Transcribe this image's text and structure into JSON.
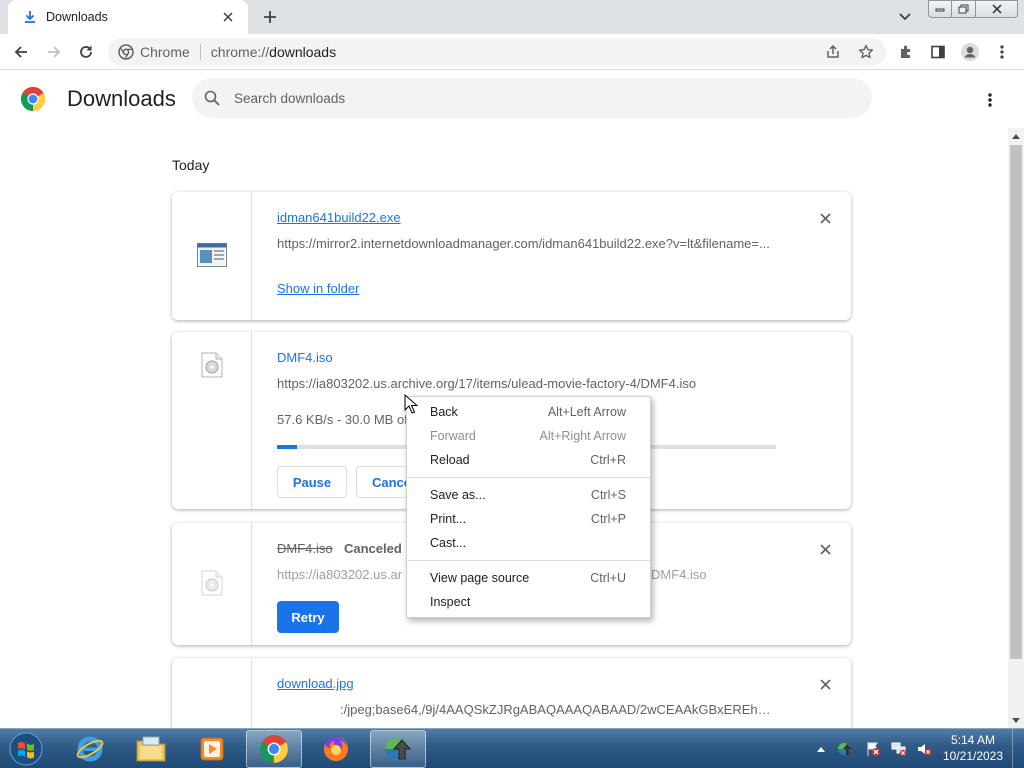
{
  "browser": {
    "tab_title": "Downloads",
    "new_tab_symbol": "+",
    "omnibox": {
      "site_label": "Chrome",
      "url_scheme": "chrome://",
      "url_host": "downloads"
    },
    "icons": [
      "download-icon",
      "close-icon",
      "plus-icon",
      "chevron-down-icon",
      "back-arrow-icon",
      "forward-arrow-icon",
      "reload-icon",
      "chrome-site-icon",
      "share-icon",
      "star-icon",
      "extensions-icon",
      "side-panel-icon",
      "profile-icon",
      "kebab-menu-icon"
    ]
  },
  "page": {
    "title": "Downloads",
    "search_placeholder": "Search downloads",
    "date_header": "Today"
  },
  "downloads": [
    {
      "filename": "idman641build22.exe",
      "url": "https://mirror2.internetdownloadmanager.com/idman641build22.exe?v=lt&filename=...",
      "action": "Show in folder"
    },
    {
      "filename": "DMF4.iso",
      "url": "https://ia803202.us.archive.org/17/items/ulead-movie-factory-4/DMF4.iso",
      "progress_text": "57.6 KB/s - 30.0 MB of",
      "progress_fraction": 0.04,
      "pause_label": "Pause",
      "cancel_label": "Cance"
    },
    {
      "filename": "DMF4.iso",
      "status": "Canceled",
      "url_left": "https://ia803202.us.ar",
      "url_right": "DMF4.iso",
      "retry_label": "Retry"
    },
    {
      "filename": "download.jpg",
      "url": ":/jpeg;base64,/9j/4AAQSkZJRgABAQAAAQABAAD/2wCEAAkGBxEREhUSE..."
    }
  ],
  "context_menu": {
    "items": [
      {
        "label": "Back",
        "shortcut": "Alt+Left Arrow",
        "disabled": false
      },
      {
        "label": "Forward",
        "shortcut": "Alt+Right Arrow",
        "disabled": true
      },
      {
        "label": "Reload",
        "shortcut": "Ctrl+R",
        "disabled": false
      },
      {
        "label": "Save as...",
        "shortcut": "Ctrl+S",
        "disabled": false
      },
      {
        "label": "Print...",
        "shortcut": "Ctrl+P",
        "disabled": false
      },
      {
        "label": "Cast...",
        "shortcut": "",
        "disabled": false
      },
      {
        "label": "View page source",
        "shortcut": "Ctrl+U",
        "disabled": false
      },
      {
        "label": "Inspect",
        "shortcut": "",
        "disabled": false
      }
    ]
  },
  "taskbar": {
    "apps": [
      "internet-explorer-icon",
      "file-explorer-icon",
      "media-player-icon",
      "chrome-icon",
      "firefox-icon",
      "idm-icon"
    ],
    "active_app": "chrome-icon",
    "clock_time": "5:14 AM",
    "clock_date": "10/21/2023"
  },
  "colors": {
    "accent": "#1a73e8",
    "tab_strip": "#dee1e6",
    "omnibox_bg": "#f1f3f4",
    "taskbar": "#2e5a85"
  }
}
